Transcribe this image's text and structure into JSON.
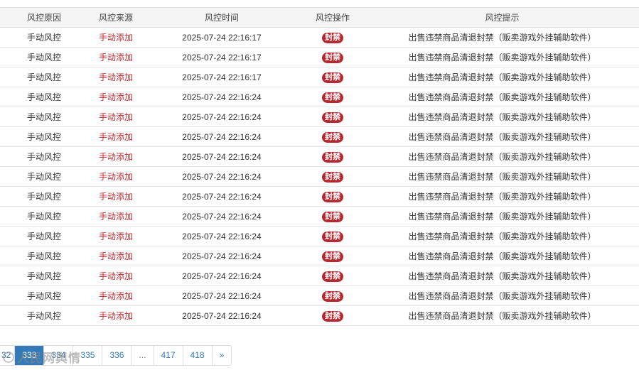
{
  "table": {
    "headers": {
      "reason": "风控原因",
      "source": "风控来源",
      "time": "风控时间",
      "operation": "风控操作",
      "tip": "风控提示"
    },
    "rows": [
      {
        "reason": "手动风控",
        "source": "手动添加",
        "time": "2025-07-24 22:16:17",
        "operation": "封禁",
        "tip": "出售违禁商品清退封禁（贩卖游戏外挂辅助软件）"
      },
      {
        "reason": "手动风控",
        "source": "手动添加",
        "time": "2025-07-24 22:16:17",
        "operation": "封禁",
        "tip": "出售违禁商品清退封禁（贩卖游戏外挂辅助软件）"
      },
      {
        "reason": "手动风控",
        "source": "手动添加",
        "time": "2025-07-24 22:16:17",
        "operation": "封禁",
        "tip": "出售违禁商品清退封禁（贩卖游戏外挂辅助软件）"
      },
      {
        "reason": "手动风控",
        "source": "手动添加",
        "time": "2025-07-24 22:16:24",
        "operation": "封禁",
        "tip": "出售违禁商品清退封禁（贩卖游戏外挂辅助软件）"
      },
      {
        "reason": "手动风控",
        "source": "手动添加",
        "time": "2025-07-24 22:16:24",
        "operation": "封禁",
        "tip": "出售违禁商品清退封禁（贩卖游戏外挂辅助软件）"
      },
      {
        "reason": "手动风控",
        "source": "手动添加",
        "time": "2025-07-24 22:16:24",
        "operation": "封禁",
        "tip": "出售违禁商品清退封禁（贩卖游戏外挂辅助软件）"
      },
      {
        "reason": "手动风控",
        "source": "手动添加",
        "time": "2025-07-24 22:16:24",
        "operation": "封禁",
        "tip": "出售违禁商品清退封禁（贩卖游戏外挂辅助软件）"
      },
      {
        "reason": "手动风控",
        "source": "手动添加",
        "time": "2025-07-24 22:16:24",
        "operation": "封禁",
        "tip": "出售违禁商品清退封禁（贩卖游戏外挂辅助软件）"
      },
      {
        "reason": "手动风控",
        "source": "手动添加",
        "time": "2025-07-24 22:16:24",
        "operation": "封禁",
        "tip": "出售违禁商品清退封禁（贩卖游戏外挂辅助软件）"
      },
      {
        "reason": "手动风控",
        "source": "手动添加",
        "time": "2025-07-24 22:16:24",
        "operation": "封禁",
        "tip": "出售违禁商品清退封禁（贩卖游戏外挂辅助软件）"
      },
      {
        "reason": "手动风控",
        "source": "手动添加",
        "time": "2025-07-24 22:16:24",
        "operation": "封禁",
        "tip": "出售违禁商品清退封禁（贩卖游戏外挂辅助软件）"
      },
      {
        "reason": "手动风控",
        "source": "手动添加",
        "time": "2025-07-24 22:16:24",
        "operation": "封禁",
        "tip": "出售违禁商品清退封禁（贩卖游戏外挂辅助软件）"
      },
      {
        "reason": "手动风控",
        "source": "手动添加",
        "time": "2025-07-24 22:16:24",
        "operation": "封禁",
        "tip": "出售违禁商品清退封禁（贩卖游戏外挂辅助软件）"
      },
      {
        "reason": "手动风控",
        "source": "手动添加",
        "time": "2025-07-24 22:16:24",
        "operation": "封禁",
        "tip": "出售违禁商品清退封禁（贩卖游戏外挂辅助软件）"
      },
      {
        "reason": "手动风控",
        "source": "手动添加",
        "time": "2025-07-24 22:16:24",
        "operation": "封禁",
        "tip": "出售违禁商品清退封禁（贩卖游戏外挂辅助软件）"
      }
    ]
  },
  "colors": {
    "source_text": "#c0282d",
    "ban_badge": "#b8282f",
    "pagination_active": "#337ab7",
    "pagination_link": "#337ab7"
  },
  "pagination": {
    "items": [
      {
        "label": "32",
        "state": "link"
      },
      {
        "label": "333",
        "state": "active"
      },
      {
        "label": "334",
        "state": "link"
      },
      {
        "label": "335",
        "state": "link"
      },
      {
        "label": "336",
        "state": "link"
      },
      {
        "label": "...",
        "state": "ellipsis"
      },
      {
        "label": "417",
        "state": "link"
      },
      {
        "label": "418",
        "state": "link"
      },
      {
        "label": "»",
        "state": "link"
      }
    ]
  },
  "watermark": {
    "text": "人民网舆情",
    "icon": "watermark-logo-icon"
  }
}
